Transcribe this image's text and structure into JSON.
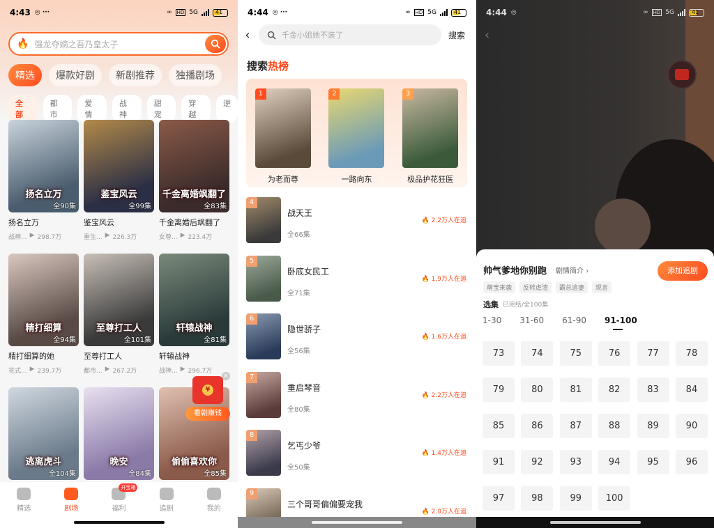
{
  "panel1": {
    "status": {
      "time": "4:43",
      "net": "5G",
      "battery": "41"
    },
    "search_placeholder": "强龙夺嫡之吾乃皇太子",
    "tabs": [
      "精选",
      "爆款好剧",
      "新剧推荐",
      "独播剧场"
    ],
    "categories": [
      "全部",
      "都市",
      "爱情",
      "战神",
      "甜宠",
      "穿越",
      "逆"
    ],
    "dramas": [
      {
        "poster_text": "扬名立万",
        "title": "扬名立万",
        "episodes": "全90集",
        "genre": "战神...",
        "views": "298.7万",
        "c1": "#4a5d6e",
        "c2": "#c9d3dc"
      },
      {
        "poster_text": "鉴宝风云",
        "title": "鉴宝风云",
        "episodes": "全99集",
        "genre": "重生...",
        "views": "226.3万",
        "c1": "#2b2f45",
        "c2": "#b38a4a"
      },
      {
        "poster_text": "千金离婚飒翻了",
        "title": "千金离婚后飒翻了",
        "episodes": "全83集",
        "genre": "女尊...",
        "views": "223.4万",
        "c1": "#3b2b2b",
        "c2": "#8a5a48"
      },
      {
        "poster_text": "精打细算",
        "title": "精打细算的她",
        "episodes": "全94集",
        "genre": "花式...",
        "views": "239.7万",
        "c1": "#5a4a45",
        "c2": "#d8c8c0"
      },
      {
        "poster_text": "至尊打工人",
        "title": "至尊打工人",
        "episodes": "全101集",
        "genre": "都市...",
        "views": "267.2万",
        "c1": "#3a3a3a",
        "c2": "#c8c0b8"
      },
      {
        "poster_text": "轩辕战神",
        "title": "轩辕战神",
        "episodes": "全81集",
        "genre": "战神...",
        "views": "296.7万",
        "c1": "#2a3a3a",
        "c2": "#7a8a7a"
      },
      {
        "poster_text": "逃离虎斗",
        "title": "",
        "episodes": "全104集",
        "genre": "",
        "views": "",
        "c1": "#6a7a8a",
        "c2": "#d0d8e0"
      },
      {
        "poster_text": "晚安",
        "title": "",
        "episodes": "全84集",
        "genre": "",
        "views": "",
        "c1": "#8a7aa8",
        "c2": "#e8e0f0"
      },
      {
        "poster_text": "偷偷喜欢你",
        "title": "",
        "episodes": "全85集",
        "genre": "",
        "views": "",
        "c1": "#8a5a4a",
        "c2": "#e0c0b0"
      }
    ],
    "redpacket_label": "看剧赚钱",
    "nav": [
      {
        "label": "精选",
        "active": false,
        "badge": ""
      },
      {
        "label": "剧场",
        "active": true,
        "badge": ""
      },
      {
        "label": "福利",
        "active": false,
        "badge": "开宝箱"
      },
      {
        "label": "追剧",
        "active": false,
        "badge": ""
      },
      {
        "label": "我的",
        "active": false,
        "badge": ""
      }
    ]
  },
  "panel2": {
    "status": {
      "time": "4:44",
      "net": "5G",
      "battery": "41"
    },
    "search_placeholder": "千金小姐她不装了",
    "search_button": "搜索",
    "hot_title_a": "搜索",
    "hot_title_b": "热榜",
    "top3": [
      {
        "rank": "1",
        "title": "为老而尊",
        "rank_color": "#ff4b1f",
        "c1": "#5a4a3a",
        "c2": "#e0d0c0"
      },
      {
        "rank": "2",
        "title": "一路向东",
        "rank_color": "#ff7a2f",
        "c1": "#6a9ab8",
        "c2": "#e8d870"
      },
      {
        "rank": "3",
        "title": "极品护花狂医",
        "rank_color": "#ffa050",
        "c1": "#3a5a3a",
        "c2": "#c8b8a0"
      }
    ],
    "list": [
      {
        "rank": "4",
        "title": "战天王",
        "episodes": "全66集",
        "hot": "2.2万人在追",
        "c1": "#3a3a3a",
        "c2": "#a08a6a"
      },
      {
        "rank": "5",
        "title": "卧底女民工",
        "episodes": "全71集",
        "hot": "1.9万人在追",
        "c1": "#4a5a4a",
        "c2": "#9aa89a"
      },
      {
        "rank": "6",
        "title": "隐世骄子",
        "episodes": "全56集",
        "hot": "1.6万人在追",
        "c1": "#2a3a5a",
        "c2": "#8a9ab0"
      },
      {
        "rank": "7",
        "title": "重启琴音",
        "episodes": "全80集",
        "hot": "2.2万人在追",
        "c1": "#5a3a3a",
        "c2": "#c8a8a0"
      },
      {
        "rank": "8",
        "title": "乞丐少爷",
        "episodes": "全50集",
        "hot": "1.4万人在追",
        "c1": "#3a3a4a",
        "c2": "#b0a0a8"
      },
      {
        "rank": "9",
        "title": "三个哥哥偏偏要宠我",
        "episodes": "",
        "hot": "2.0万人在追",
        "c1": "#6a5a4a",
        "c2": "#d8c8b8"
      }
    ],
    "rank_badge_color": "#f0a070"
  },
  "panel3": {
    "status": {
      "time": "4:44",
      "net": "5G",
      "battery": "41"
    },
    "drama_title": "帅气爹地你别跑",
    "intro_link": "剧情简介",
    "follow_button": "添加追剧",
    "tags": [
      "萌宝来袭",
      "反转虐渣",
      "霸总追妻",
      "现言"
    ],
    "select_label": "选集",
    "select_status": "已完结/全100集",
    "ranges": [
      "1-30",
      "31-60",
      "61-90",
      "91-100"
    ],
    "active_range": "91-100",
    "episodes": [
      "73",
      "74",
      "75",
      "76",
      "77",
      "78",
      "79",
      "80",
      "81",
      "82",
      "83",
      "84",
      "85",
      "86",
      "87",
      "88",
      "89",
      "90",
      "91",
      "92",
      "93",
      "94",
      "95",
      "96",
      "97",
      "98",
      "99",
      "100"
    ]
  }
}
